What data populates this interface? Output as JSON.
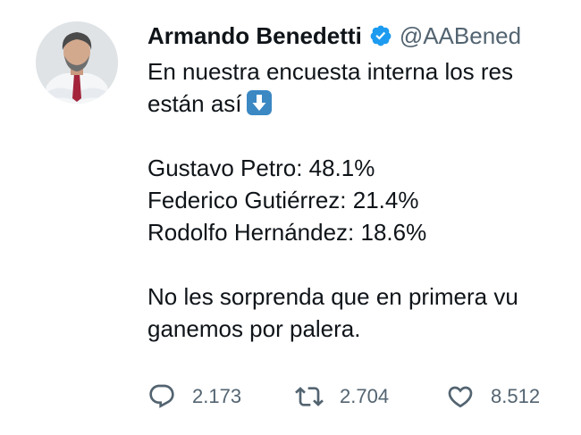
{
  "author": {
    "name": "Armando Benedetti",
    "handle": "@AABened",
    "verified": true,
    "avatar_icon": "profile-photo"
  },
  "tweet": {
    "lines": [
      "En nuestra encuesta interna los res",
      "están así"
    ],
    "results": [
      "Gustavo Petro: 48.1%",
      "Federico Gutiérrez: 21.4%",
      "Rodolfo Hernández: 18.6%"
    ],
    "closing": [
      "No les sorprenda que en primera vu",
      "ganemos por palera."
    ],
    "emoji": "down-arrow-emoji"
  },
  "actions": {
    "replies": "2.173",
    "retweets": "2.704",
    "likes": "8.512"
  },
  "colors": {
    "text": "#0f1419",
    "secondary": "#536471",
    "verified": "#1d9bf0"
  }
}
